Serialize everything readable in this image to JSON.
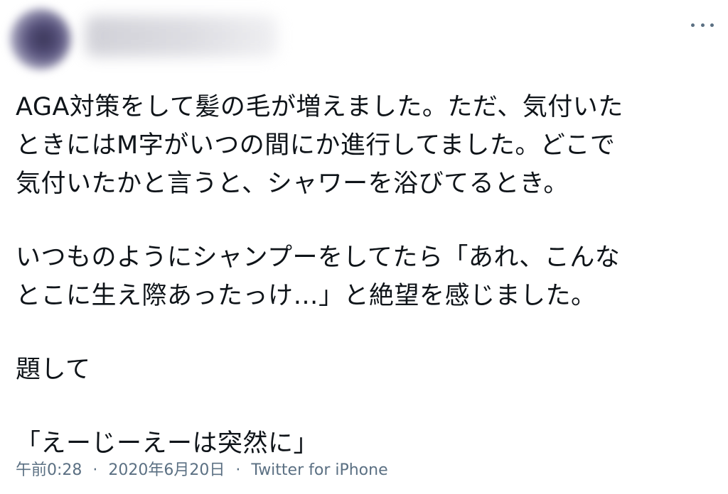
{
  "tweet": {
    "paragraphs": [
      "AGA対策をして髪の毛が増えました。ただ、気付いた\nときにはM字がいつの間にか進行してました。どこで\n気付いたかと言うと、シャワーを浴びてるとき。",
      "いつものようにシャンプーをしてたら「あれ、こんな\nとこに生え際あったっけ…」と絶望を感じました。",
      "題して",
      "「えーじーえーは突然に」"
    ],
    "time": "午前0:28",
    "separator": "·",
    "date": "2020年6月20日",
    "source": "Twitter for iPhone"
  },
  "icons": {
    "more": "more-dots-icon"
  },
  "colors": {
    "text": "#0f1419",
    "meta": "#5b7083",
    "background": "#ffffff"
  }
}
